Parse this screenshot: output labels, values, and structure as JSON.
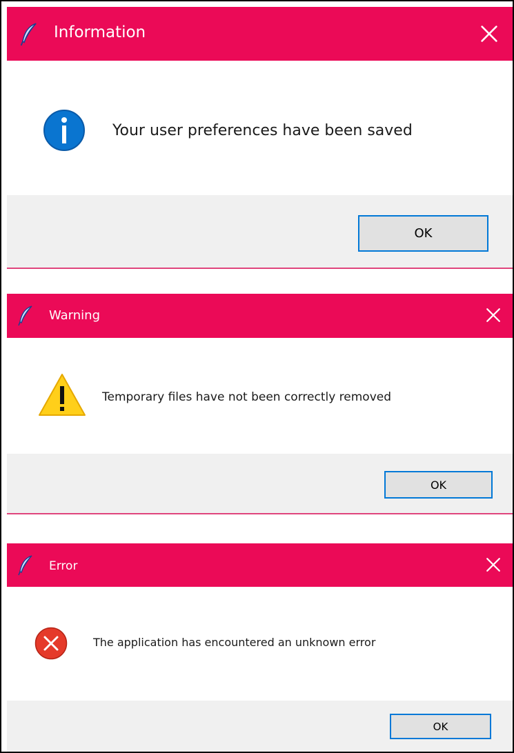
{
  "colors": {
    "titlebar": "#eb0a57",
    "separator": "#e0447c",
    "footer": "#f0f0f0",
    "button_border": "#0078d7",
    "info_icon": "#0a75d0",
    "warning_icon": "#ffcf1a",
    "error_icon": "#e53a2a"
  },
  "dialogs": [
    {
      "title": "Information",
      "app_icon": "feather-icon",
      "close_icon": "close-icon",
      "message_icon": "info-icon",
      "message": "Your user preferences have been saved",
      "ok_label": "OK"
    },
    {
      "title": "Warning",
      "app_icon": "feather-icon",
      "close_icon": "close-icon",
      "message_icon": "warning-icon",
      "message": "Temporary files have not been correctly removed",
      "ok_label": "OK"
    },
    {
      "title": "Error",
      "app_icon": "feather-icon",
      "close_icon": "close-icon",
      "message_icon": "error-icon",
      "message": "The application has encountered an unknown error",
      "ok_label": "OK"
    }
  ]
}
